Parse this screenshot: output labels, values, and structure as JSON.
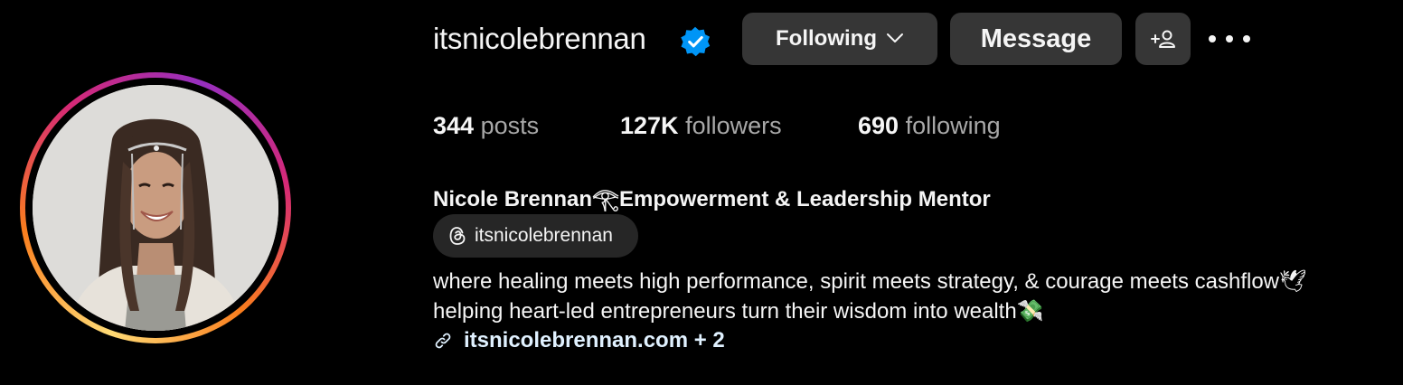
{
  "profile": {
    "username": "itsnicolebrennan",
    "verified": true,
    "full_name": "Nicole Brennan𓂀Empowerment & Leadership Mentor",
    "threads_handle": "itsnicolebrennan",
    "bio_line1": "where healing meets high performance, spirit meets strategy, & courage meets cashflow🕊",
    "bio_line2": "helping heart-led entrepreneurs turn their wisdom into wealth💸",
    "link_text": "itsnicolebrennan.com + 2"
  },
  "actions": {
    "following_label": "Following",
    "following_chevron": "﹀",
    "message_label": "Message"
  },
  "stats": {
    "posts_count": "344",
    "posts_label": "posts",
    "followers_count": "127K",
    "followers_label": "followers",
    "following_count": "690",
    "following_label": "following"
  },
  "icons": {
    "verified": "verified-badge-icon",
    "add_user": "add-user-icon",
    "more": "more-options-icon",
    "threads": "threads-logo-icon",
    "link": "link-icon"
  },
  "colors": {
    "background": "#000000",
    "button_bg": "#363636",
    "verified_blue": "#0095f6",
    "muted_text": "#a8a8a8"
  }
}
